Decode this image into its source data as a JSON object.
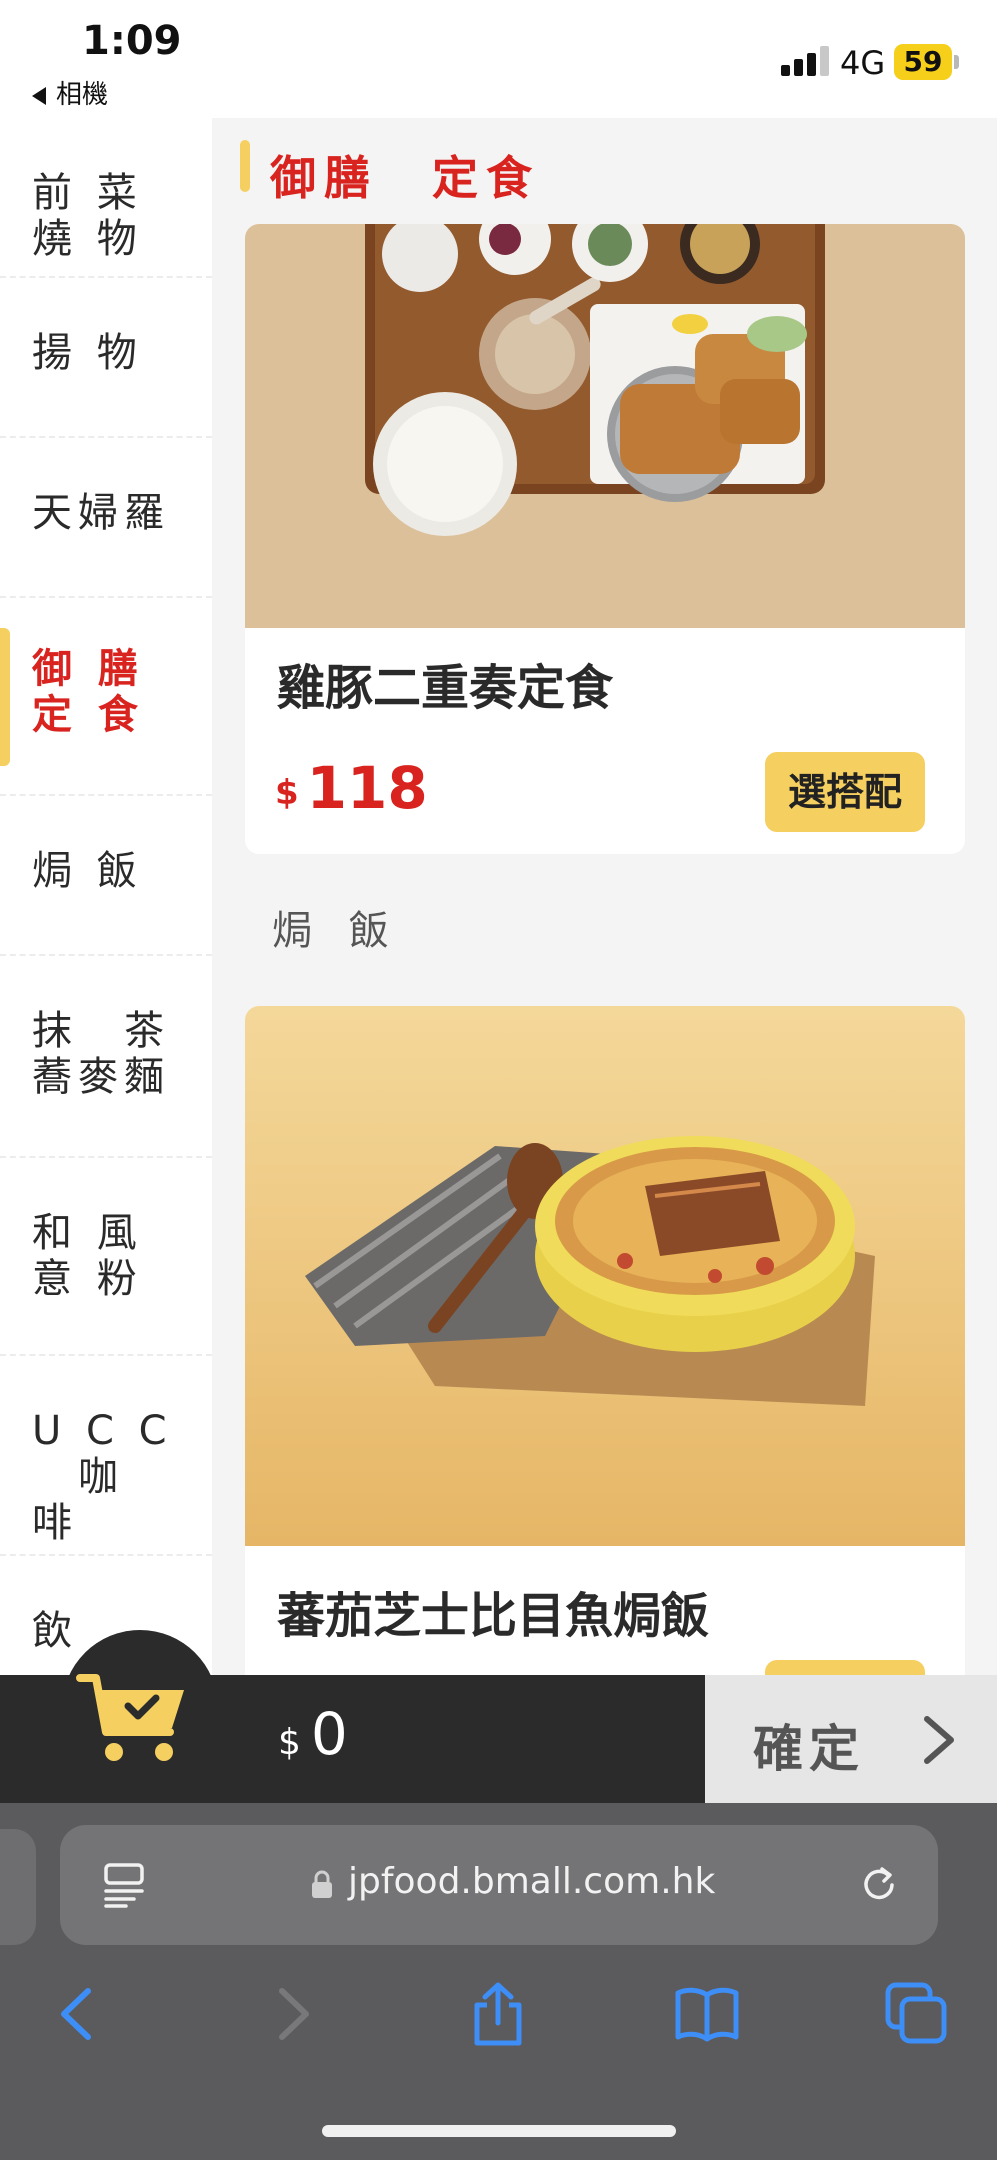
{
  "status_bar": {
    "time": "1:09",
    "back_label": "相機",
    "network": "4G",
    "battery": "59"
  },
  "sidebar": {
    "items": [
      {
        "label": "前 菜\n燒 物",
        "active": false
      },
      {
        "label": "揚 物",
        "active": false
      },
      {
        "label": "天婦羅",
        "active": false
      },
      {
        "label": "御 膳\n定 食",
        "active": true
      },
      {
        "label": "焗 飯",
        "active": false
      },
      {
        "label": "抹　茶\n蕎麥麵",
        "active": false
      },
      {
        "label": "和 風\n意 粉",
        "active": false
      },
      {
        "label": "U C C\n　咖 啡",
        "active": false
      },
      {
        "label": "飲",
        "active": false
      }
    ]
  },
  "section_header": {
    "title": "御膳　定食"
  },
  "products": [
    {
      "name": "雞豚二重奏定食",
      "currency": "$",
      "price": "118",
      "option_label": "選搭配"
    },
    {
      "name": "蕃茄芝士比目魚焗飯",
      "currency": "$",
      "price": "",
      "option_label": ""
    }
  ],
  "group_label": "焗 飯",
  "cart": {
    "currency": "$",
    "total": "0",
    "confirm_label": "確定"
  },
  "browser": {
    "url": "jpfood.bmall.com.hk"
  },
  "colors": {
    "accent_red": "#d8231f",
    "accent_yellow": "#f5cf60",
    "cart_bar": "#2b2b2b",
    "safari_toolbar": "#5b5b5d",
    "safari_blue": "#3d8ef7"
  },
  "icons": [
    "signal-icon",
    "battery-icon",
    "cart-icon",
    "chevron-right-icon",
    "reader-icon",
    "lock-icon",
    "reload-icon",
    "back-icon",
    "forward-icon",
    "share-icon",
    "bookmarks-icon",
    "tabs-icon"
  ]
}
